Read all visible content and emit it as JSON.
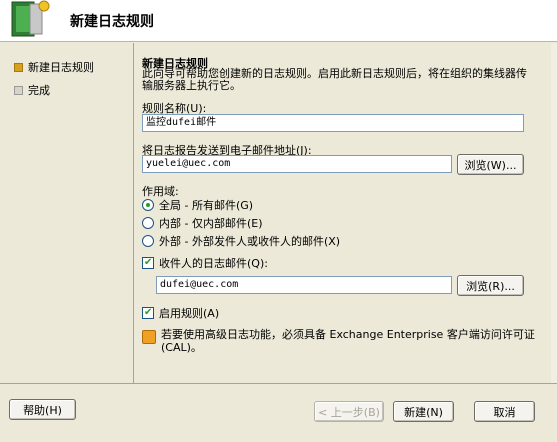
{
  "wizard": {
    "title": "新建日志规则"
  },
  "nav": {
    "items": [
      {
        "label": "新建日志规则",
        "active": true
      },
      {
        "label": "完成",
        "active": false
      }
    ]
  },
  "section": {
    "title": "新建日志规则",
    "description": "此向导可帮助您创建新的日志规则。启用此新日志规则后，将在组织的集线器传输服务器上执行它。"
  },
  "rule_name": {
    "label": "规则名称(U):",
    "value": "监控dufei邮件"
  },
  "report_address": {
    "label": "将日志报告发送到电子邮件地址(J):",
    "value": "yuelei@uec.com",
    "browse_label": "浏览(W)..."
  },
  "scope": {
    "label": "作用域:",
    "options": [
      {
        "label": "全局 - 所有邮件(G)",
        "selected": true
      },
      {
        "label": "内部 - 仅内部邮件(E)",
        "selected": false
      },
      {
        "label": "外部 - 外部发件人或收件人的邮件(X)",
        "selected": false
      }
    ]
  },
  "recipient_journal": {
    "label": "收件人的日志邮件(Q):",
    "checked": true,
    "value": "dufei@uec.com",
    "browse_label": "浏览(R)..."
  },
  "enable_rule": {
    "label": "启用规则(A)",
    "checked": true
  },
  "note": {
    "text": "若要使用高级日志功能，必须具备 Exchange Enterprise 客户端访问许可证(CAL)。"
  },
  "footer": {
    "help_label": "帮助(H)",
    "back_label": "< 上一步(B)",
    "new_label": "新建(N)",
    "cancel_label": "取消"
  },
  "colors": {
    "active_nav": "#d6a21e",
    "check_green": "#21a121",
    "textbox_border": "#7f9db9"
  }
}
